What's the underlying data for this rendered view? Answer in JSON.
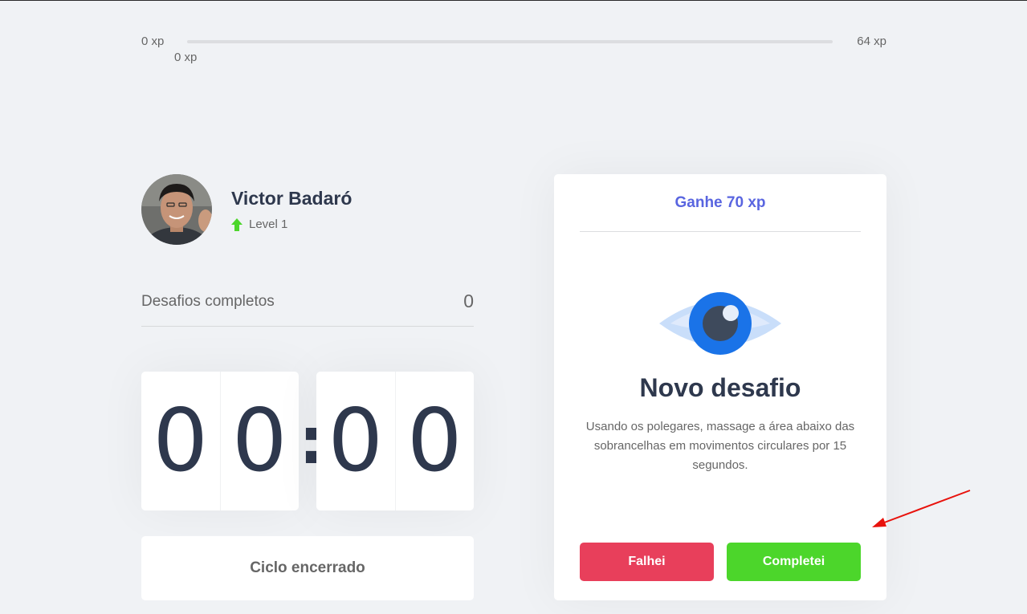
{
  "xp_bar": {
    "min_label": "0 xp",
    "max_label": "64 xp",
    "current_label": "0 xp",
    "progress_fraction": 0
  },
  "profile": {
    "name": "Victor Badaró",
    "level_label": "Level 1",
    "level_icon": "level-up-arrow-icon"
  },
  "completed_challenges": {
    "label": "Desafios completos",
    "value": "0"
  },
  "countdown": {
    "minute_left": "0",
    "minute_right": "0",
    "separator": ":",
    "second_left": "0",
    "second_right": "0"
  },
  "cycle_button": {
    "label": "Ciclo encerrado"
  },
  "challenge": {
    "header": "Ganhe 70 xp",
    "icon": "eye-icon",
    "title": "Novo desafio",
    "description": "Usando os polegares, massage a área abaixo das sobrancelhas em movimentos circulares por 15 segundos.",
    "fail_label": "Falhei",
    "success_label": "Completei"
  },
  "colors": {
    "background": "#f0f2f5",
    "accent": "#5965e0",
    "success": "#4cd62b",
    "danger": "#e83f5b",
    "title": "#2e384d",
    "text": "#666666",
    "annotation": "#e8120c"
  }
}
